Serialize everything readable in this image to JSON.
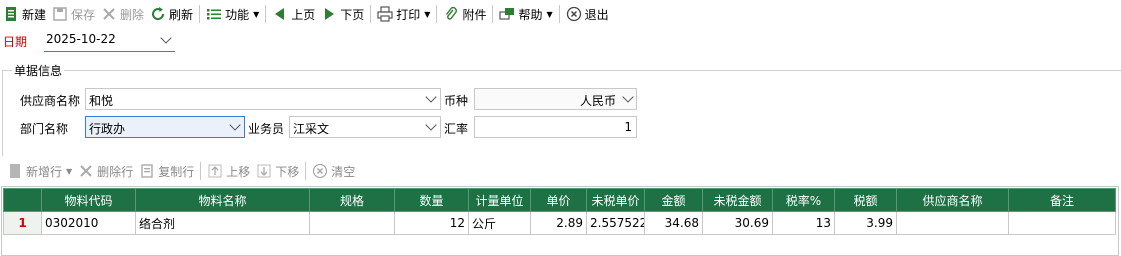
{
  "toolbar": {
    "new": "新建",
    "save": "保存",
    "delete": "删除",
    "refresh": "刷新",
    "functions": "功能",
    "prev_page": "上页",
    "next_page": "下页",
    "print": "打印",
    "attachment": "附件",
    "help": "帮助",
    "exit": "退出"
  },
  "date": {
    "label": "日期",
    "value": "2025-10-22"
  },
  "section": {
    "title": "单据信息"
  },
  "form": {
    "supplier_label": "供应商名称",
    "supplier_value": "和悦",
    "currency_label": "币种",
    "currency_value": "人民币",
    "dept_label": "部门名称",
    "dept_value": "行政办",
    "salesman_label": "业务员",
    "salesman_value": "江采文",
    "rate_label": "汇率",
    "rate_value": "1"
  },
  "grid_toolbar": {
    "add_row": "新增行",
    "delete_row": "删除行",
    "copy_row": "复制行",
    "move_up": "上移",
    "move_down": "下移",
    "clear": "清空"
  },
  "grid": {
    "columns": [
      "物料代码",
      "物料名称",
      "规格",
      "数量",
      "计量单位",
      "单价",
      "未税单价",
      "金额",
      "未税金额",
      "税率%",
      "税额",
      "供应商名称",
      "备注"
    ],
    "rows": [
      {
        "no": "1",
        "code": "0302010",
        "name": "络合剂",
        "spec": "",
        "qty": "12",
        "unit": "公斤",
        "price": "2.89",
        "price_ex_tax": "2.557522",
        "amount": "34.68",
        "amount_ex_tax": "30.69",
        "tax_rate": "13",
        "tax": "3.99",
        "supplier": "",
        "remark": ""
      }
    ]
  },
  "colors": {
    "header_green": "#1e7145",
    "label_red": "#d40000",
    "focus_blue": "#3a7bd5"
  }
}
